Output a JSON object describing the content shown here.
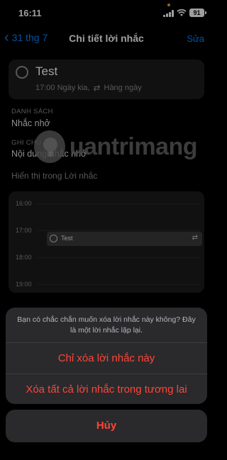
{
  "status_bar": {
    "time": "16:11",
    "battery": "91"
  },
  "nav": {
    "back_label": "31 thg 7",
    "title": "Chi tiết lời nhắc",
    "edit_label": "Sửa"
  },
  "reminder": {
    "title": "Test",
    "time_text": "17:00 Ngày kia,",
    "repeat_text": "Hàng ngày"
  },
  "list_section": {
    "label": "DANH SÁCH",
    "value": "Nhắc nhở"
  },
  "notes_section": {
    "label": "GHI CHÚ",
    "value": "Nội dung nhắc nhở"
  },
  "show_in_label": "Hiển thị trong Lời nhắc",
  "calendar": {
    "hours": [
      "16:00",
      "17:00",
      "18:00",
      "19:00"
    ],
    "event_title": "Test"
  },
  "watermark": "uantrimang",
  "action_sheet": {
    "message": "Bạn có chắc chắn muốn xóa lời nhắc này không? Đây là một lời nhắc lặp lại.",
    "option_this": "Chỉ xóa lời nhắc này",
    "option_future": "Xóa tất cả lời nhắc trong tương lai",
    "cancel": "Hủy"
  },
  "colors": {
    "accent": "#0a84ff",
    "destructive": "#ff453a",
    "background": "#000000",
    "card": "#1c1c1e"
  }
}
